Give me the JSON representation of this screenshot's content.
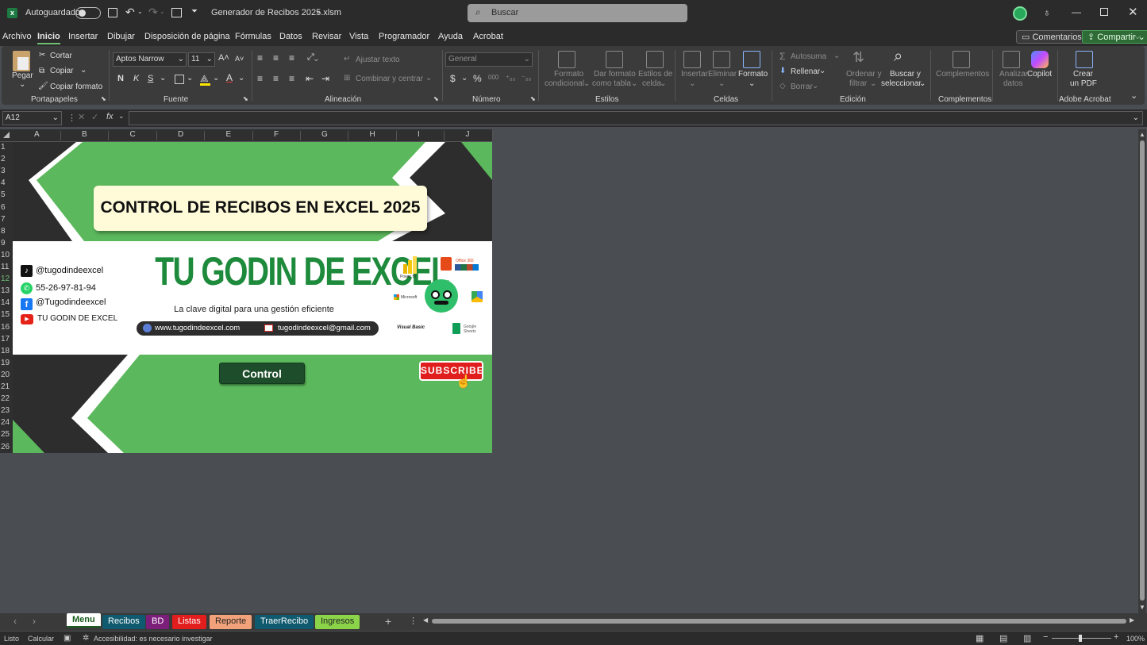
{
  "titlebar": {
    "autosave_label": "Autoguardado",
    "filename": "Generador de Recibos 2025.xlsm",
    "search_placeholder": "Buscar"
  },
  "menu": {
    "tabs": [
      "Archivo",
      "Inicio",
      "Insertar",
      "Dibujar",
      "Disposición de página",
      "Fórmulas",
      "Datos",
      "Revisar",
      "Vista",
      "Programador",
      "Ayuda",
      "Acrobat"
    ],
    "comments_label": "Comentarios",
    "share_label": "Compartir"
  },
  "ribbon": {
    "portapapeles": {
      "paste": "Pegar",
      "cut": "Cortar",
      "copy": "Copiar",
      "format_painter": "Copiar formato",
      "group": "Portapapeles"
    },
    "fuente": {
      "font": "Aptos Narrow",
      "size": "11",
      "group": "Fuente"
    },
    "alineacion": {
      "wrap": "Ajustar texto",
      "merge": "Combinar y centrar",
      "group": "Alineación"
    },
    "numero": {
      "format": "General",
      "group": "Número"
    },
    "estilos": {
      "cond1": "Formato",
      "cond2": "condicional",
      "table1": "Dar formato",
      "table2": "como tabla",
      "cell1": "Estilos de",
      "cell2": "celda",
      "group": "Estilos"
    },
    "celdas": {
      "insert": "Insertar",
      "delete": "Eliminar",
      "format": "Formato",
      "group": "Celdas"
    },
    "edicion": {
      "autosum": "Autosuma",
      "fill": "Rellenar",
      "clear": "Borrar",
      "sort1": "Ordenar y",
      "sort2": "filtrar",
      "find1": "Buscar y",
      "find2": "seleccionar",
      "group": "Edición"
    },
    "complementos": {
      "addins": "Complementos",
      "analyze1": "Analizar",
      "analyze2": "datos",
      "copilot": "Copilot",
      "group": "Complementos"
    },
    "acrobat": {
      "pdf1": "Crear",
      "pdf2": "un PDF",
      "group": "Adobe Acrobat"
    }
  },
  "formula_bar": {
    "namebox": "A12",
    "fx": "fx",
    "content": ""
  },
  "columns": [
    "A",
    "B",
    "C",
    "D",
    "E",
    "F",
    "G",
    "H",
    "I",
    "J"
  ],
  "rows": [
    "1",
    "2",
    "3",
    "4",
    "5",
    "6",
    "7",
    "8",
    "9",
    "10",
    "11",
    "12",
    "13",
    "14",
    "15",
    "16",
    "17",
    "18",
    "19",
    "20",
    "21",
    "22",
    "23",
    "24",
    "25",
    "26"
  ],
  "banner": {
    "title": "CONTROL DE RECIBOS EN EXCEL 2025",
    "brand": "TU GODIN DE EXCEL",
    "tagline": "La clave digital para una gestión eficiente",
    "website": "www.tugodindeexcel.com",
    "email": "tugodindeexcel@gmail.com",
    "social": [
      {
        "icon": "tiktok-icon",
        "text": "@tugodindeexcel"
      },
      {
        "icon": "whatsapp-icon",
        "text": "55-26-97-81-94"
      },
      {
        "icon": "facebook-icon",
        "text": "@Tugodindeexcel"
      },
      {
        "icon": "youtube-icon",
        "text": "TU GODIN DE EXCEL"
      }
    ],
    "logos": {
      "powerbi": "Power BI",
      "office": "Office 365",
      "microsoft": "Microsoft",
      "vba": "Visual Basic",
      "sheets": "Google Sheets"
    },
    "control_button": "Control",
    "subscribe": "SUBSCRIBE",
    "colors": {
      "green": "#5cb85c",
      "dark": "#2d2d2d",
      "white": "#ffffff",
      "button": "#1e4d2b"
    }
  },
  "sheet_tabs": [
    {
      "label": "Menu",
      "bg": "#ffffff",
      "fg": "#1b5e20",
      "active": true
    },
    {
      "label": "Recibos",
      "bg": "#0f5a6e",
      "fg": "#ffffff"
    },
    {
      "label": "BD",
      "bg": "#7b1f7b",
      "fg": "#ffffff"
    },
    {
      "label": "Listas",
      "bg": "#e11d1d",
      "fg": "#ffffff"
    },
    {
      "label": "Reporte",
      "bg": "#f2a27a",
      "fg": "#222222"
    },
    {
      "label": "TraerRecibo",
      "bg": "#0f5a6e",
      "fg": "#ffffff"
    },
    {
      "label": "Ingresos",
      "bg": "#8bd44a",
      "fg": "#222222"
    }
  ],
  "status": {
    "ready": "Listo",
    "calc": "Calcular",
    "accessibility": "Accesibilidad: es necesario investigar",
    "zoom": "100%"
  }
}
